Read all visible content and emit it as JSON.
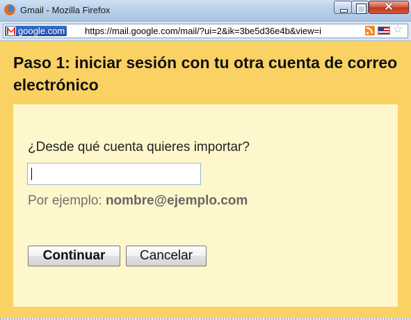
{
  "window": {
    "title": "Gmail - Mozilla Firefox"
  },
  "urlbar": {
    "site_identity": "google.com",
    "url": "https://mail.google.com/mail/?ui=2&ik=3be5d36e4b&view=i"
  },
  "dialog": {
    "heading": "Paso 1: iniciar sesión con tu otra cuenta de correo electrónico",
    "question": "¿Desde qué cuenta quieres importar?",
    "email_value": "",
    "example_prefix": "Por ejemplo: ",
    "example_email": "nombre@ejemplo.com",
    "continue_label": "Continuar",
    "cancel_label": "Cancelar"
  },
  "colors": {
    "dialog_background": "#fad163",
    "panel_background": "#fff7cc"
  },
  "icons": [
    "firefox-icon",
    "minimize-icon",
    "maximize-icon",
    "close-icon",
    "gmail-icon",
    "rss-icon",
    "us-flag-icon",
    "bookmark-star-icon"
  ]
}
